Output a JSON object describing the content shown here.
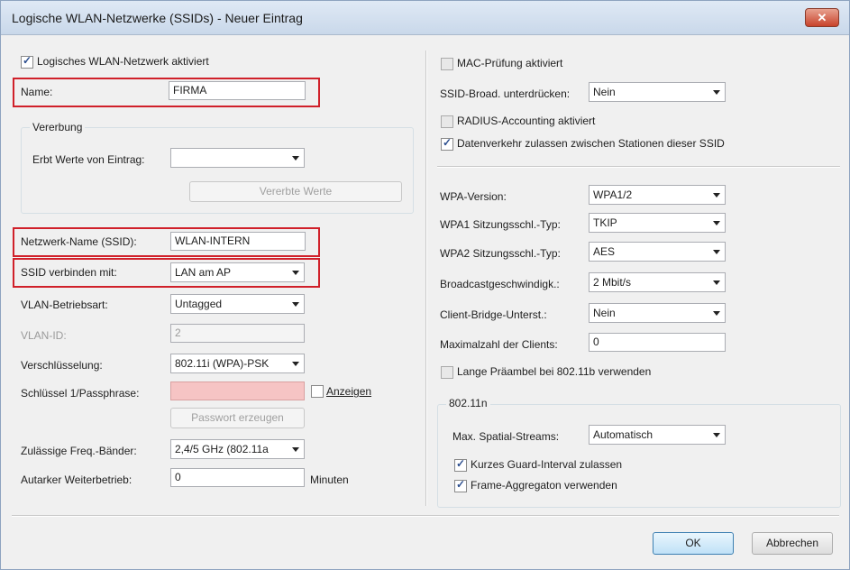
{
  "window": {
    "title": "Logische WLAN-Netzwerke (SSIDs) - Neuer Eintrag",
    "close_glyph": "✕"
  },
  "left": {
    "enabled_label": "Logisches WLAN-Netzwerk aktiviert",
    "name_label": "Name:",
    "name_value": "FIRMA",
    "inheritance_title": "Vererbung",
    "inherits_label": "Erbt Werte von Eintrag:",
    "inherits_value": "",
    "inherit_button": "Vererbte Werte",
    "ssid_label": "Netzwerk-Name (SSID):",
    "ssid_value": "WLAN-INTERN",
    "connect_label": "SSID verbinden mit:",
    "connect_value": "LAN am AP",
    "vlan_mode_label": "VLAN-Betriebsart:",
    "vlan_mode_value": "Untagged",
    "vlan_id_label": "VLAN-ID:",
    "vlan_id_value": "2",
    "encryption_label": "Verschlüsselung:",
    "encryption_value": "802.11i (WPA)-PSK",
    "key_label": "Schlüssel 1/Passphrase:",
    "key_value": "",
    "show_label": "Anzeigen",
    "gen_password_button": "Passwort erzeugen",
    "freq_label": "Zulässige Freq.-Bänder:",
    "freq_value": "2,4/5 GHz (802.11a",
    "autark_label": "Autarker Weiterbetrieb:",
    "autark_value": "0",
    "autark_unit": "Minuten"
  },
  "right": {
    "mac_label": "MAC-Prüfung aktiviert",
    "ssid_broadcast_label": "SSID-Broad. unterdrücken:",
    "ssid_broadcast_value": "Nein",
    "radius_label": "RADIUS-Accounting aktiviert",
    "traffic_label": "Datenverkehr zulassen zwischen Stationen dieser SSID",
    "wpa_version_label": "WPA-Version:",
    "wpa_version_value": "WPA1/2",
    "wpa1_label": "WPA1 Sitzungsschl.-Typ:",
    "wpa1_value": "TKIP",
    "wpa2_label": "WPA2 Sitzungsschl.-Typ:",
    "wpa2_value": "AES",
    "broadcast_speed_label": "Broadcastgeschwindigk.:",
    "broadcast_speed_value": "2 Mbit/s",
    "client_bridge_label": "Client-Bridge-Unterst.:",
    "client_bridge_value": "Nein",
    "max_clients_label": "Maximalzahl der Clients:",
    "max_clients_value": "0",
    "preamble_label": "Lange Präambel bei 802.11b verwenden",
    "n_title": "802.11n",
    "spatial_label": "Max. Spatial-Streams:",
    "spatial_value": "Automatisch",
    "guard_label": "Kurzes Guard-Interval zulassen",
    "aggregation_label": "Frame-Aggregaton verwenden"
  },
  "footer": {
    "ok_label": "OK",
    "cancel_label": "Abbrechen"
  }
}
